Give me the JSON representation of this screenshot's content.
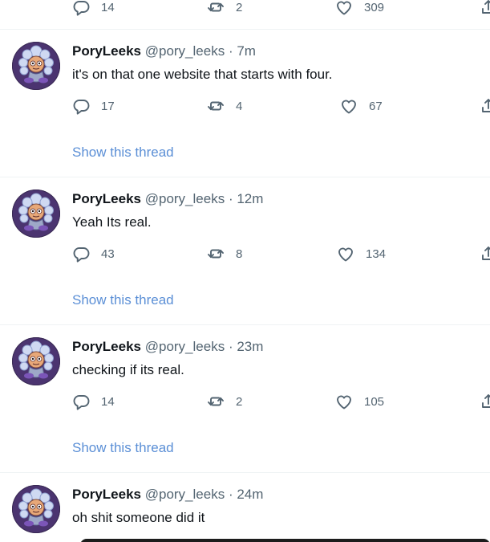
{
  "icons": {
    "reply": "reply-icon",
    "retweet": "retweet-icon",
    "like": "like-icon",
    "share": "share-icon"
  },
  "colors": {
    "link": "#5b8fd6",
    "meta": "#536471",
    "separator": "#eff3f4"
  },
  "top_partial": {
    "replies": "14",
    "retweets": "2",
    "likes": "309"
  },
  "tweets": [
    {
      "name": "PoryLeeks",
      "handle": "@pory_leeks",
      "dot": "·",
      "time": "7m",
      "text": "it's on that one website that starts with four.",
      "replies": "17",
      "retweets": "4",
      "likes": "67",
      "thread_link": "Show this thread"
    },
    {
      "name": "PoryLeeks",
      "handle": "@pory_leeks",
      "dot": "·",
      "time": "12m",
      "text": "Yeah Its real.",
      "replies": "43",
      "retweets": "8",
      "likes": "134",
      "thread_link": "Show this thread"
    },
    {
      "name": "PoryLeeks",
      "handle": "@pory_leeks",
      "dot": "·",
      "time": "23m",
      "text": "checking if its real.",
      "replies": "14",
      "retweets": "2",
      "likes": "105",
      "thread_link": "Show this thread"
    },
    {
      "name": "PoryLeeks",
      "handle": "@pory_leeks",
      "dot": "·",
      "time": "24m",
      "text": "oh shit someone did it"
    }
  ]
}
